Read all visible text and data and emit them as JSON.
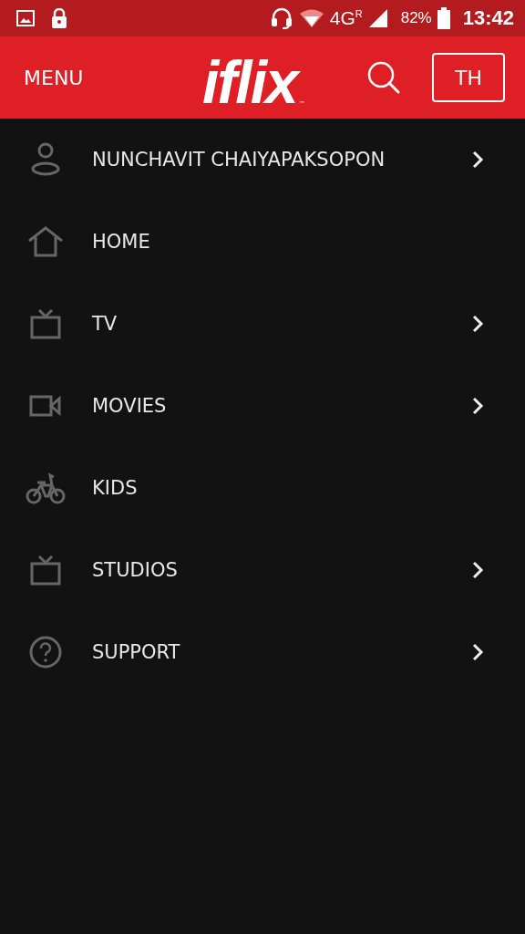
{
  "status_bar": {
    "network": "4G",
    "roaming": "R",
    "battery": "82%",
    "time": "13:42"
  },
  "header": {
    "menu": "MENU",
    "logo": "iflix",
    "trademark": "™",
    "language": "TH"
  },
  "menu_items": [
    {
      "kind": "profile",
      "label": "NUNCHAVIT CHAIYAPAKSOPON",
      "has_chevron": true
    },
    {
      "kind": "home",
      "label": "HOME",
      "has_chevron": false
    },
    {
      "kind": "tv",
      "label": "TV",
      "has_chevron": true
    },
    {
      "kind": "video",
      "label": "MOVIES",
      "has_chevron": true
    },
    {
      "kind": "bike",
      "label": "KIDS",
      "has_chevron": false
    },
    {
      "kind": "tv",
      "label": "STUDIOS",
      "has_chevron": true
    },
    {
      "kind": "help",
      "label": "SUPPORT",
      "has_chevron": true
    }
  ]
}
